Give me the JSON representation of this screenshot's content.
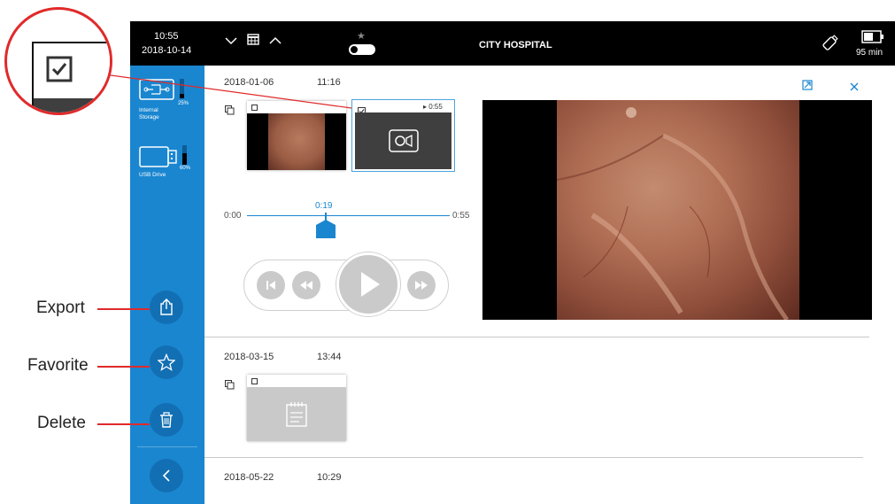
{
  "topbar": {
    "time": "10:55",
    "date": "2018-10-14",
    "hospital": "CITY HOSPITAL",
    "battery": "95 min"
  },
  "sidebar": {
    "internal_storage_label_1": "Internal",
    "internal_storage_label_2": "Storage",
    "internal_storage_pct": "25%",
    "usb_label": "USB Drive",
    "usb_pct": "60%"
  },
  "callouts": {
    "export": "Export",
    "favorite": "Favorite",
    "delete": "Delete"
  },
  "records": [
    {
      "date": "2018-01-06",
      "time": "11:16"
    },
    {
      "date": "2018-03-15",
      "time": "13:44"
    },
    {
      "date": "2018-05-22",
      "time": "10:29"
    }
  ],
  "video_thumb": {
    "duration": "▸ 0:55"
  },
  "player": {
    "start": "0:00",
    "current": "0:19",
    "end": "0:55",
    "progress": 0.345
  },
  "colors": {
    "accent": "#1a86d0",
    "callout": "#e02a2a",
    "topbar": "#000000"
  }
}
